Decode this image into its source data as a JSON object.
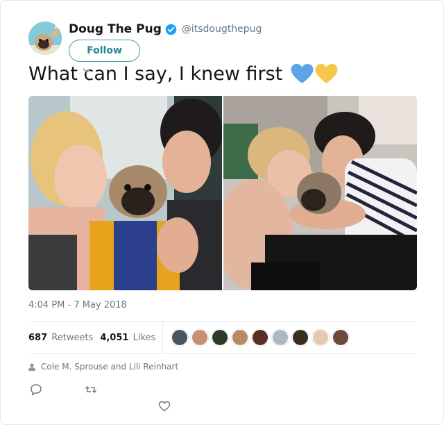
{
  "user": {
    "name": "Doug The Pug",
    "handle": "@itsdougthepug",
    "verified": true,
    "follow_label": "Follow"
  },
  "tweet": {
    "text": "What can I say, I knew first",
    "emoji": [
      "blue-heart",
      "yellow-heart"
    ],
    "timestamp": "4:04 PM - 7 May 2018"
  },
  "stats": {
    "retweets_count": "687",
    "retweets_label": "Retweets",
    "likes_count": "4,051",
    "likes_label": "Likes",
    "liker_avatars": 9
  },
  "mentioned_people": "Cole M. Sprouse and Lili Reinhart",
  "actions": [
    "reply-icon",
    "retweet-icon",
    "like-icon"
  ],
  "colors": {
    "text": "#14171a",
    "secondary": "#657786",
    "follow_accent": "#1d8a8f",
    "verified_blue": "#1da1f2",
    "blue_heart": "#5da4e6",
    "yellow_heart": "#f5c84c"
  }
}
